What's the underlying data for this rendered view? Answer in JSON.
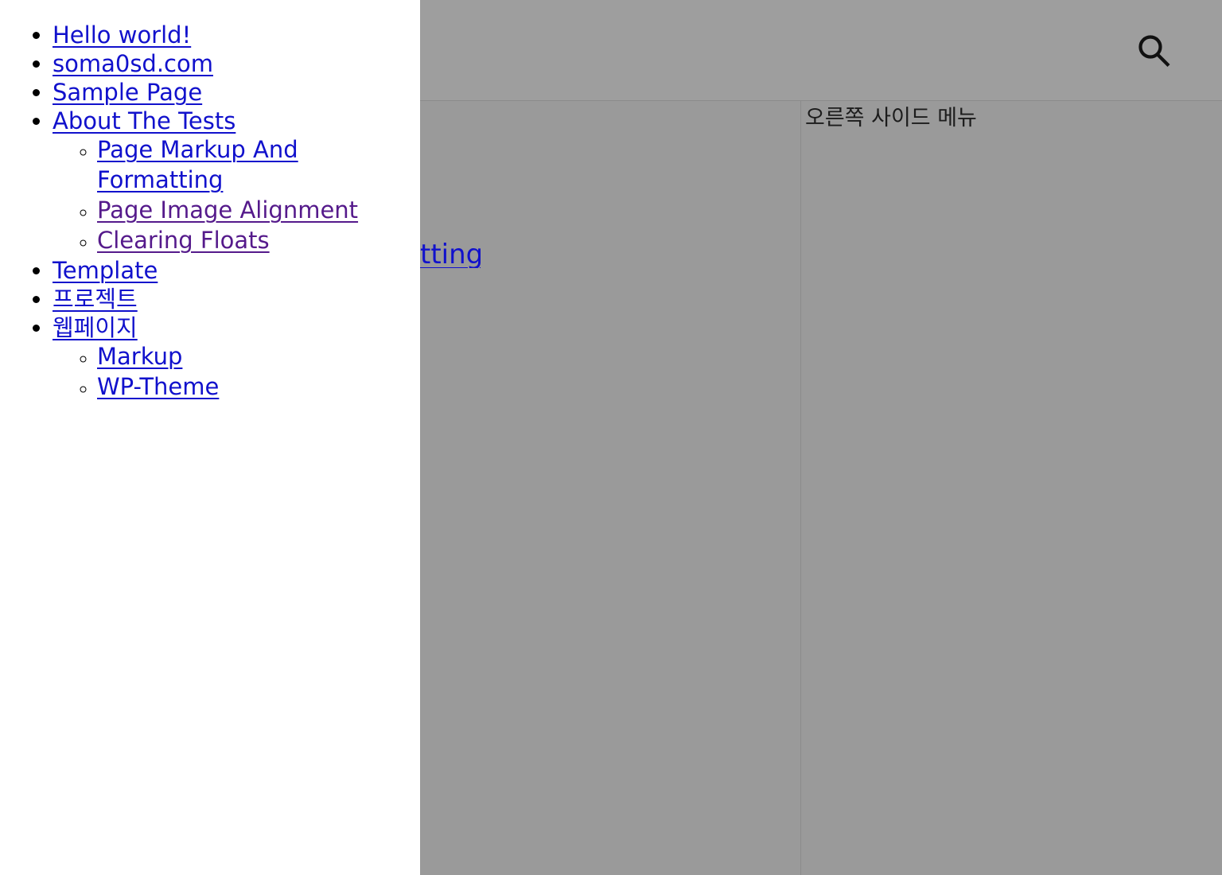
{
  "page": {
    "background_color": "#ffffff",
    "overlay_color": "#9a9a9a",
    "link_color": "#1111cc",
    "visited_link_color": "#551a8b"
  },
  "header": {
    "search_icon": "search-icon",
    "search_label": "Search"
  },
  "right_sidebar": {
    "title": "오른쪽 사이드 메뉴"
  },
  "content_fragment": {
    "text": "tting"
  },
  "menu": {
    "items": [
      {
        "label": "Hello world!",
        "visited": false,
        "children": []
      },
      {
        "label": "soma0sd.com",
        "visited": false,
        "children": []
      },
      {
        "label": "Sample Page",
        "visited": false,
        "children": []
      },
      {
        "label": "About The Tests",
        "visited": false,
        "children": [
          {
            "label": "Page Markup And Formatting",
            "visited": false
          },
          {
            "label": "Page Image Alignment",
            "visited": true
          },
          {
            "label": "Clearing Floats",
            "visited": true
          }
        ]
      },
      {
        "label": "Template",
        "visited": false,
        "children": []
      },
      {
        "label": "프로젝트",
        "visited": false,
        "children": []
      },
      {
        "label": "웹페이지",
        "visited": false,
        "children": [
          {
            "label": "Markup",
            "visited": false
          },
          {
            "label": "WP-Theme",
            "visited": false
          }
        ]
      }
    ]
  }
}
